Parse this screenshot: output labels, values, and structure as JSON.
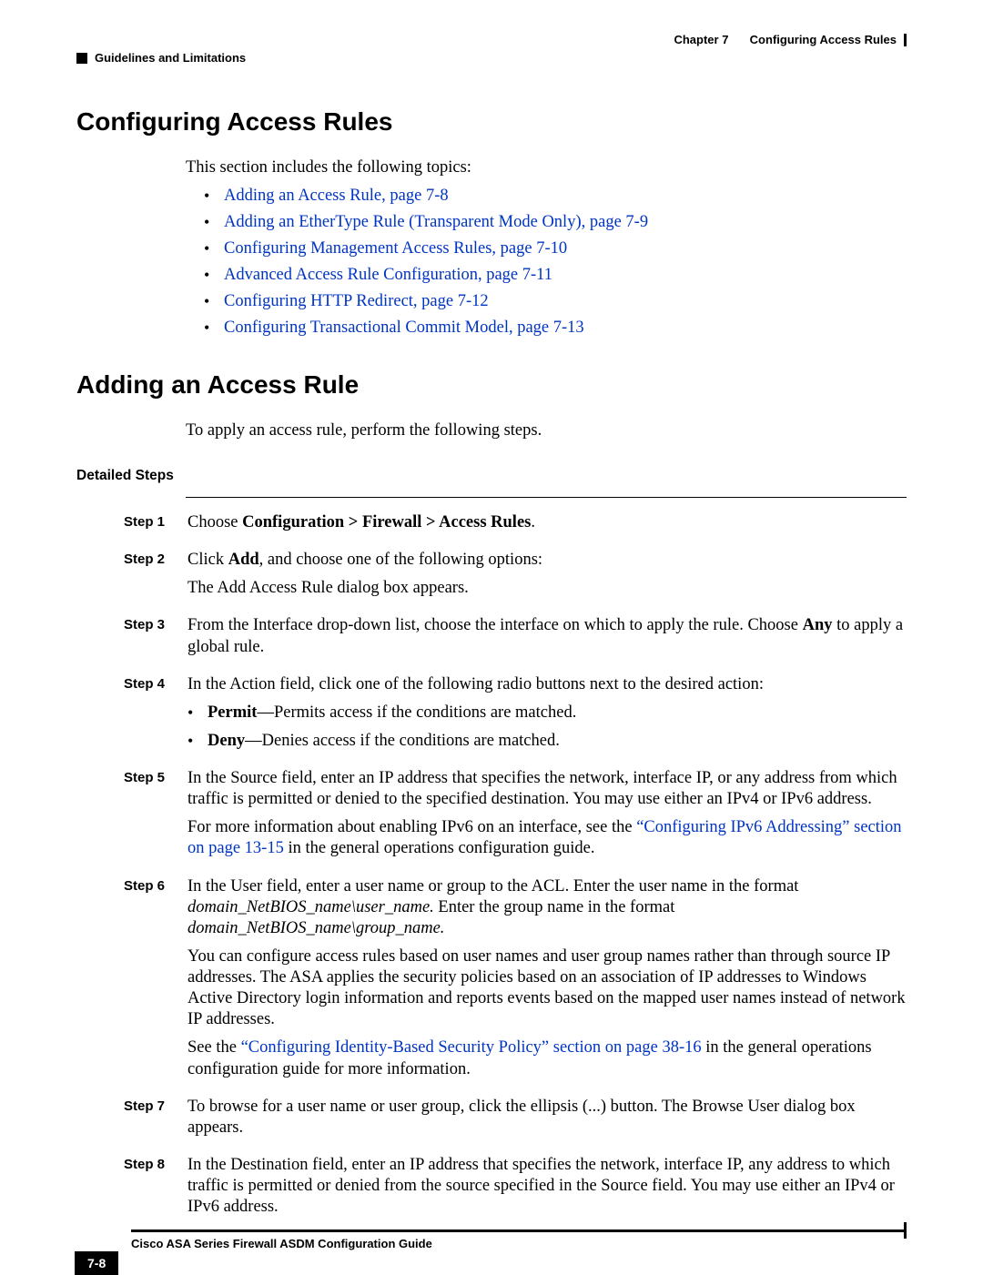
{
  "header": {
    "chapter_label": "Chapter 7",
    "chapter_title": "Configuring Access Rules",
    "section": "Guidelines and Limitations"
  },
  "h1_top": "Configuring Access Rules",
  "intro_top": "This section includes the following topics:",
  "topic_links": [
    "Adding an Access Rule, page 7-8",
    "Adding an EtherType Rule (Transparent Mode Only), page 7-9",
    "Configuring Management Access Rules, page 7-10",
    "Advanced Access Rule Configuration, page 7-11",
    "Configuring HTTP Redirect, page 7-12",
    "Configuring Transactional Commit Model, page 7-13"
  ],
  "h1_second": "Adding an Access Rule",
  "intro_second": "To apply an access rule, perform the following steps.",
  "detailed_steps_heading": "Detailed Steps",
  "steps": {
    "s1_label": "Step 1",
    "s1_t1": "Choose ",
    "s1_bold": "Configuration > Firewall > Access Rules",
    "s1_t2": ".",
    "s2_label": "Step 2",
    "s2_t1": "Click ",
    "s2_bold": "Add",
    "s2_t2": ", and choose one of the following options:",
    "s2_p2": "The Add Access Rule dialog box appears.",
    "s3_label": "Step 3",
    "s3_t1": "From the Interface drop-down list, choose the interface on which to apply the rule. Choose ",
    "s3_bold": "Any",
    "s3_t2": " to apply a global rule.",
    "s4_label": "Step 4",
    "s4_p1": "In the Action field, click one of the following radio buttons next to the desired action:",
    "s4_b1_bold": "Permit",
    "s4_b1_rest": "—Permits access if the conditions are matched.",
    "s4_b2_bold": "Deny",
    "s4_b2_rest": "—Denies access if the conditions are matched.",
    "s5_label": "Step 5",
    "s5_p1": "In the Source field, enter an IP address that specifies the network, interface IP, or any address from which traffic is permitted or denied to the specified destination. You may use either an IPv4 or IPv6 address.",
    "s5_p2a": "For more information about enabling IPv6 on an interface, see the ",
    "s5_link": "“Configuring IPv6 Addressing” section on page 13-15",
    "s5_p2b": " in the general operations configuration guide.",
    "s6_label": "Step 6",
    "s6_p1a": "In the User field, enter a user name or group to the ACL. Enter the user name in the format ",
    "s6_it1": "domain_NetBIOS_name\\user_name.",
    "s6_p1b": " Enter the group name in the format ",
    "s6_it2": "domain_NetBIOS_name\\group_name.",
    "s6_p2": "You can configure access rules based on user names and user group names rather than through source IP addresses. The ASA applies the security policies based on an association of IP addresses to Windows Active Directory login information and reports events based on the mapped user names instead of network IP addresses.",
    "s6_p3a": "See the ",
    "s6_link": "“Configuring Identity-Based Security Policy” section on page 38-16",
    "s6_p3b": " in the general operations configuration guide for more information.",
    "s7_label": "Step 7",
    "s7_p1": "To browse for a user name or user group, click the ellipsis (...) button. The Browse User dialog box appears.",
    "s8_label": "Step 8",
    "s8_p1": "In the Destination field, enter an IP address that specifies the network, interface IP, any address to which traffic is permitted or denied from the source specified in the Source field. You may use either an IPv4 or IPv6 address."
  },
  "footer": {
    "guide": "Cisco ASA Series Firewall ASDM Configuration Guide",
    "page": "7-8"
  }
}
